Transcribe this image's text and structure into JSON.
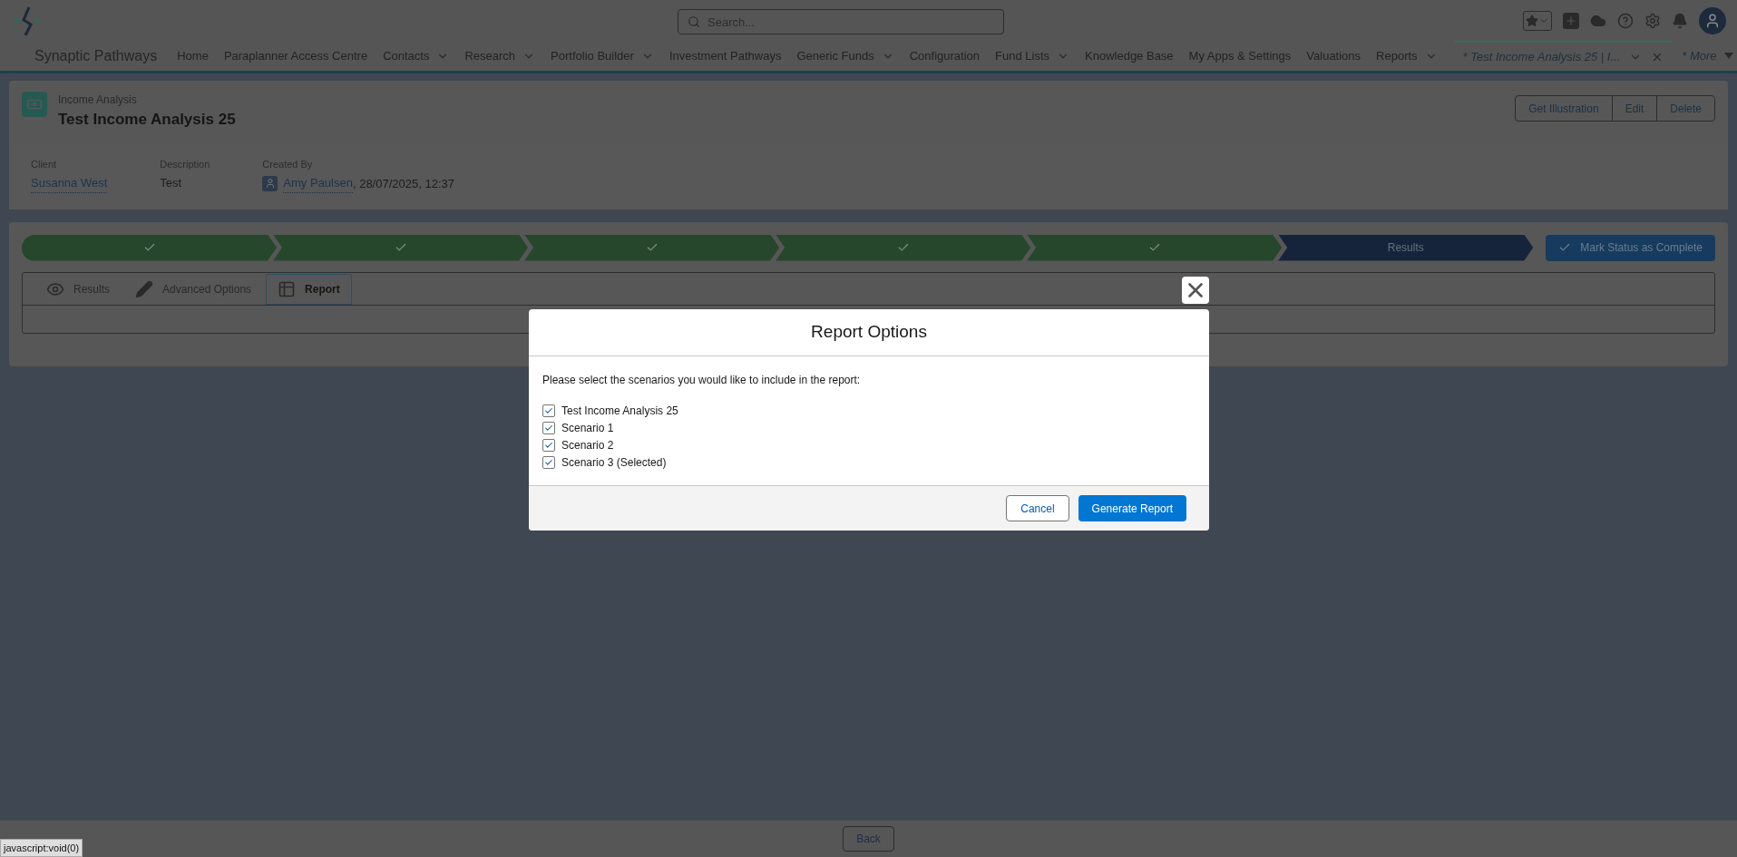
{
  "header": {
    "search": {
      "placeholder": "Search..."
    },
    "app_name": "Synaptic Pathways"
  },
  "nav": [
    {
      "label": "Home",
      "has_menu": false
    },
    {
      "label": "Paraplanner Access Centre",
      "has_menu": false
    },
    {
      "label": "Contacts",
      "has_menu": true
    },
    {
      "label": "Research",
      "has_menu": true
    },
    {
      "label": "Portfolio Builder",
      "has_menu": true
    },
    {
      "label": "Investment Pathways",
      "has_menu": false
    },
    {
      "label": "Generic Funds",
      "has_menu": true
    },
    {
      "label": "Configuration",
      "has_menu": false
    },
    {
      "label": "Fund Lists",
      "has_menu": true
    },
    {
      "label": "Knowledge Base",
      "has_menu": false
    },
    {
      "label": "My Apps & Settings",
      "has_menu": false
    },
    {
      "label": "Valuations",
      "has_menu": false
    },
    {
      "label": "Reports",
      "has_menu": true
    }
  ],
  "open_tab": {
    "label": "* Test Income Analysis 25 | I...",
    "selected": true
  },
  "more": {
    "label": "* More"
  },
  "record": {
    "type": "Income Analysis",
    "title": "Test Income Analysis 25",
    "actions": [
      "Get Illustration",
      "Edit",
      "Delete"
    ],
    "fields": [
      {
        "label": "Client",
        "kind": "link",
        "value": "Susanna West"
      },
      {
        "label": "Description",
        "kind": "text",
        "value": "Test"
      },
      {
        "label": "Created By",
        "kind": "user",
        "value": "Amy Paulsen",
        "suffix": ", 28/07/2025, 12:37"
      }
    ]
  },
  "path": {
    "stages": [
      {
        "complete": true
      },
      {
        "complete": true
      },
      {
        "complete": true
      },
      {
        "complete": true
      },
      {
        "complete": true
      },
      {
        "complete": false,
        "label": "Results"
      }
    ],
    "button": "Mark Status as Complete"
  },
  "tabs": [
    {
      "label": "Results",
      "kind": "eye",
      "selected": false
    },
    {
      "label": "Advanced Options",
      "kind": "pencil",
      "selected": false
    },
    {
      "label": "Report",
      "kind": "table",
      "selected": true
    }
  ],
  "modal": {
    "title": "Report Options",
    "prompt": "Please select the scenarios you would like to include in the report:",
    "options": [
      {
        "label": "Test Income Analysis 25",
        "checked": true
      },
      {
        "label": "Scenario 1",
        "checked": true
      },
      {
        "label": "Scenario 2",
        "checked": true
      },
      {
        "label": "Scenario 3 (Selected)",
        "checked": true
      }
    ],
    "cancel": "Cancel",
    "confirm": "Generate Report"
  },
  "footer": {
    "back": "Back"
  },
  "status_url": "javascript:void(0)"
}
